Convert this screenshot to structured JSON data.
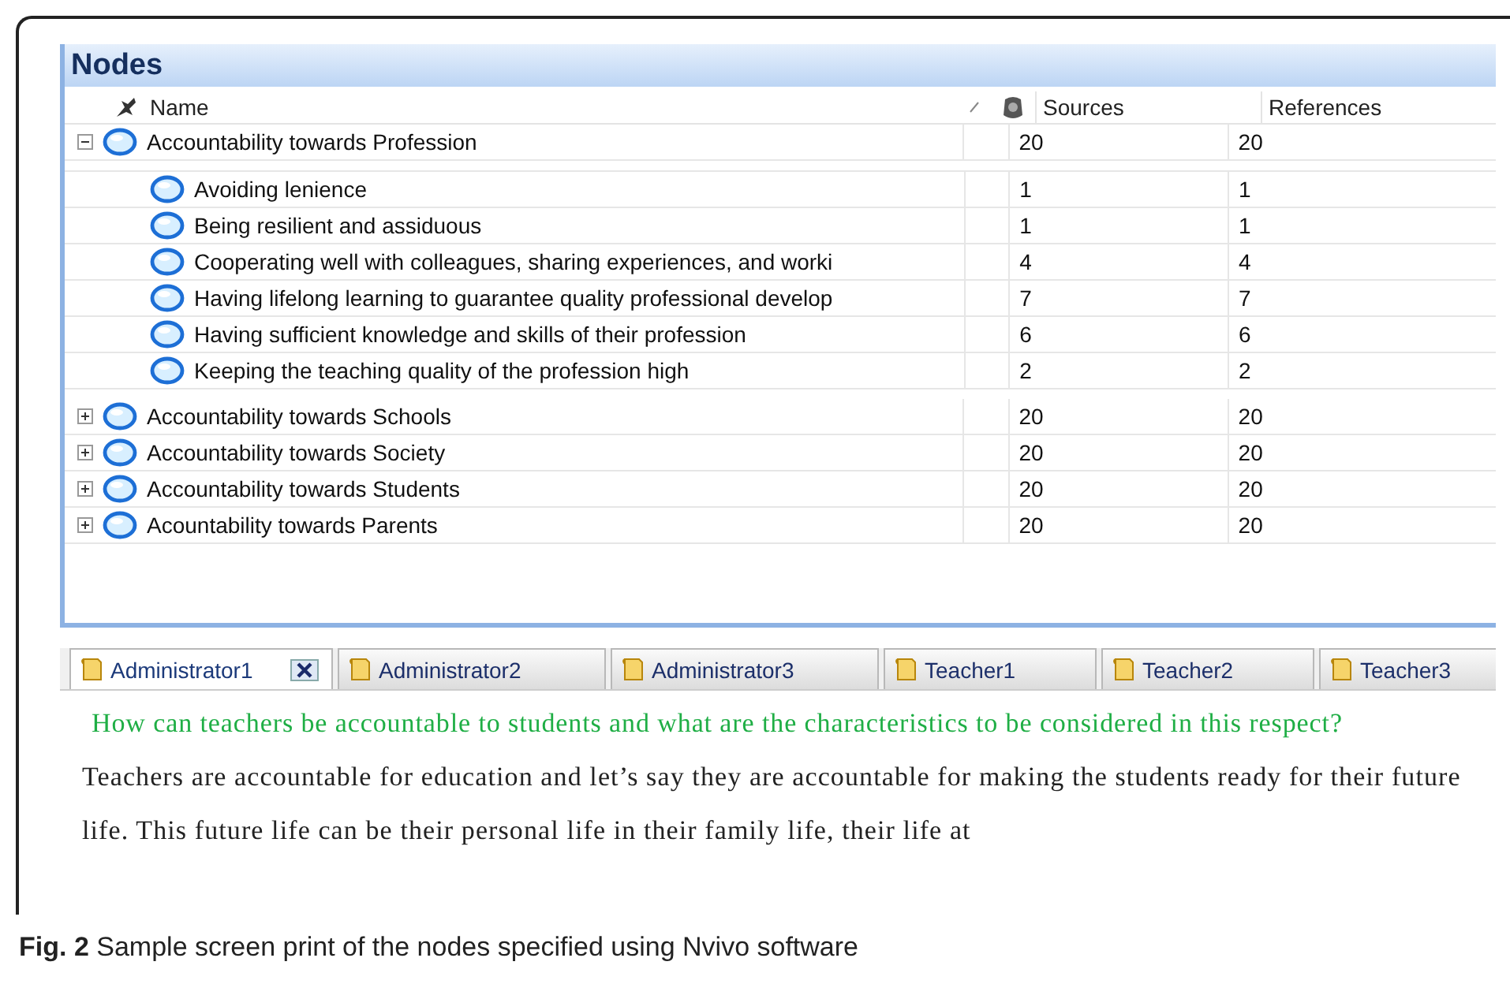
{
  "panel": {
    "title": "Nodes"
  },
  "columns": [
    "Name",
    "Sources",
    "References"
  ],
  "nodes": [
    {
      "name": "Accountability towards Profession",
      "sources": "20",
      "references": "20",
      "expanded": true,
      "children": [
        {
          "name": "Avoiding lenience",
          "sources": "1",
          "references": "1"
        },
        {
          "name": "Being resilient and assiduous",
          "sources": "1",
          "references": "1"
        },
        {
          "name": "Cooperating well with colleagues, sharing experiences, and worki",
          "sources": "4",
          "references": "4"
        },
        {
          "name": "Having lifelong learning to guarantee quality professional develop",
          "sources": "7",
          "references": "7"
        },
        {
          "name": "Having sufficient knowledge and skills of their profession",
          "sources": "6",
          "references": "6"
        },
        {
          "name": "Keeping the teaching quality of the profession high",
          "sources": "2",
          "references": "2"
        }
      ]
    },
    {
      "name": "Accountability towards Schools",
      "sources": "20",
      "references": "20",
      "expanded": false
    },
    {
      "name": "Accountability towards Society",
      "sources": "20",
      "references": "20",
      "expanded": false
    },
    {
      "name": "Accountability towards Students",
      "sources": "20",
      "references": "20",
      "expanded": false
    },
    {
      "name": "Acountability towards Parents",
      "sources": "20",
      "references": "20",
      "expanded": false
    }
  ],
  "tabs": [
    {
      "label": "Administrator1",
      "selected": true
    },
    {
      "label": "Administrator2",
      "selected": false
    },
    {
      "label": "Administrator3",
      "selected": false
    },
    {
      "label": "Teacher1",
      "selected": false
    },
    {
      "label": "Teacher2",
      "selected": false
    },
    {
      "label": "Teacher3",
      "selected": false
    }
  ],
  "document": {
    "question": "How can teachers be accountable to students and what are the characteristics to be considered in this respect?",
    "answer": "Teachers are accountable for education and let’s say they are accountable for making the students ready for their future life. This future life can be their personal life in their family life, their life at"
  },
  "caption": "**Fig. 2** Sample screen print of the nodes specified using Nvivo software"
}
